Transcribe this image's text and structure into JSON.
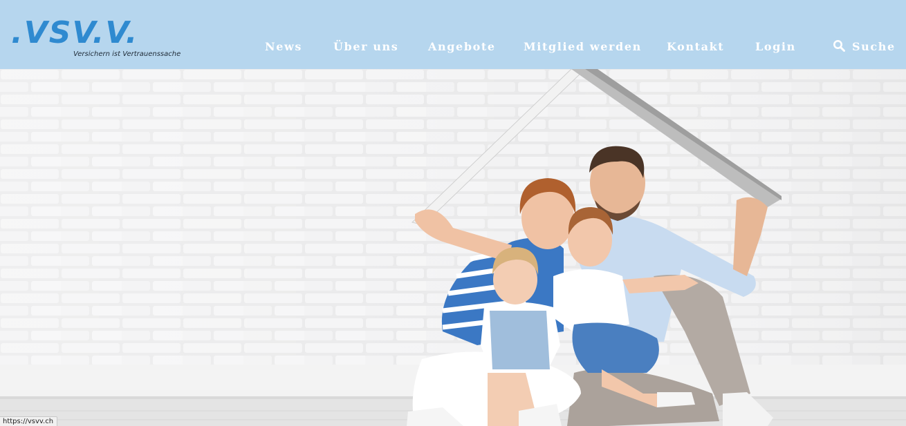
{
  "logo": {
    "text": ".VSV.V.",
    "tagline": "Versichern ist Vertrauenssache"
  },
  "nav": {
    "news": "News",
    "ueber_uns": "Über uns",
    "angebote": "Angebote",
    "mitglied_werden": "Mitglied werden",
    "kontakt": "Kontakt",
    "login": "Login",
    "suche": "Suche"
  },
  "status_bar": {
    "url": "https://vsvv.ch"
  },
  "colors": {
    "header_bg": "#b6d6ee",
    "logo_blue": "#2f8ad0",
    "nav_text": "#ffffff"
  },
  "icons": {
    "search": "search-icon"
  }
}
